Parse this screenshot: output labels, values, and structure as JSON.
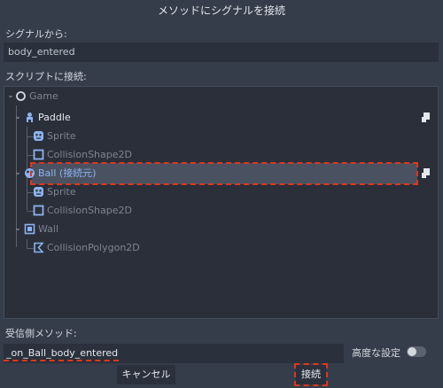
{
  "dialog": {
    "title": "メソッドにシグナルを接続",
    "from_signal_label": "シグナルから:",
    "signal_name": "body_entered",
    "connect_to_script_label": "スクリプトに接続:",
    "receiver_method_label": "受信側メソッド:",
    "receiver_method_value": "_on_Ball_body_entered",
    "advanced_label": "高度な設定",
    "advanced_enabled": false,
    "cancel_label": "キャンセル",
    "connect_label": "接続"
  },
  "tree": {
    "nodes": [
      {
        "name": "Game",
        "icon": "node-circle-icon",
        "state": "dim"
      },
      {
        "name": "Paddle",
        "icon": "kinematic-body-icon",
        "state": "bright",
        "has_script": true
      },
      {
        "name": "Sprite",
        "icon": "sprite-icon",
        "state": "dim"
      },
      {
        "name": "CollisionShape2D",
        "icon": "collision-shape-icon",
        "state": "dim"
      },
      {
        "name": "Ball (接続元)",
        "icon": "rigid-body-icon",
        "state": "selected",
        "has_script": true
      },
      {
        "name": "Sprite",
        "icon": "sprite-icon",
        "state": "dim"
      },
      {
        "name": "CollisionShape2D",
        "icon": "collision-shape-icon",
        "state": "dim"
      },
      {
        "name": "Wall",
        "icon": "static-body-icon",
        "state": "dim"
      },
      {
        "name": "CollisionPolygon2D",
        "icon": "collision-polygon-icon",
        "state": "dim"
      }
    ]
  },
  "colors": {
    "background": "#363d4a",
    "field": "#2b313c",
    "selected": "#4a5261",
    "accent_blue": "#8db3f0",
    "highlight_dash": "#e0361c"
  }
}
